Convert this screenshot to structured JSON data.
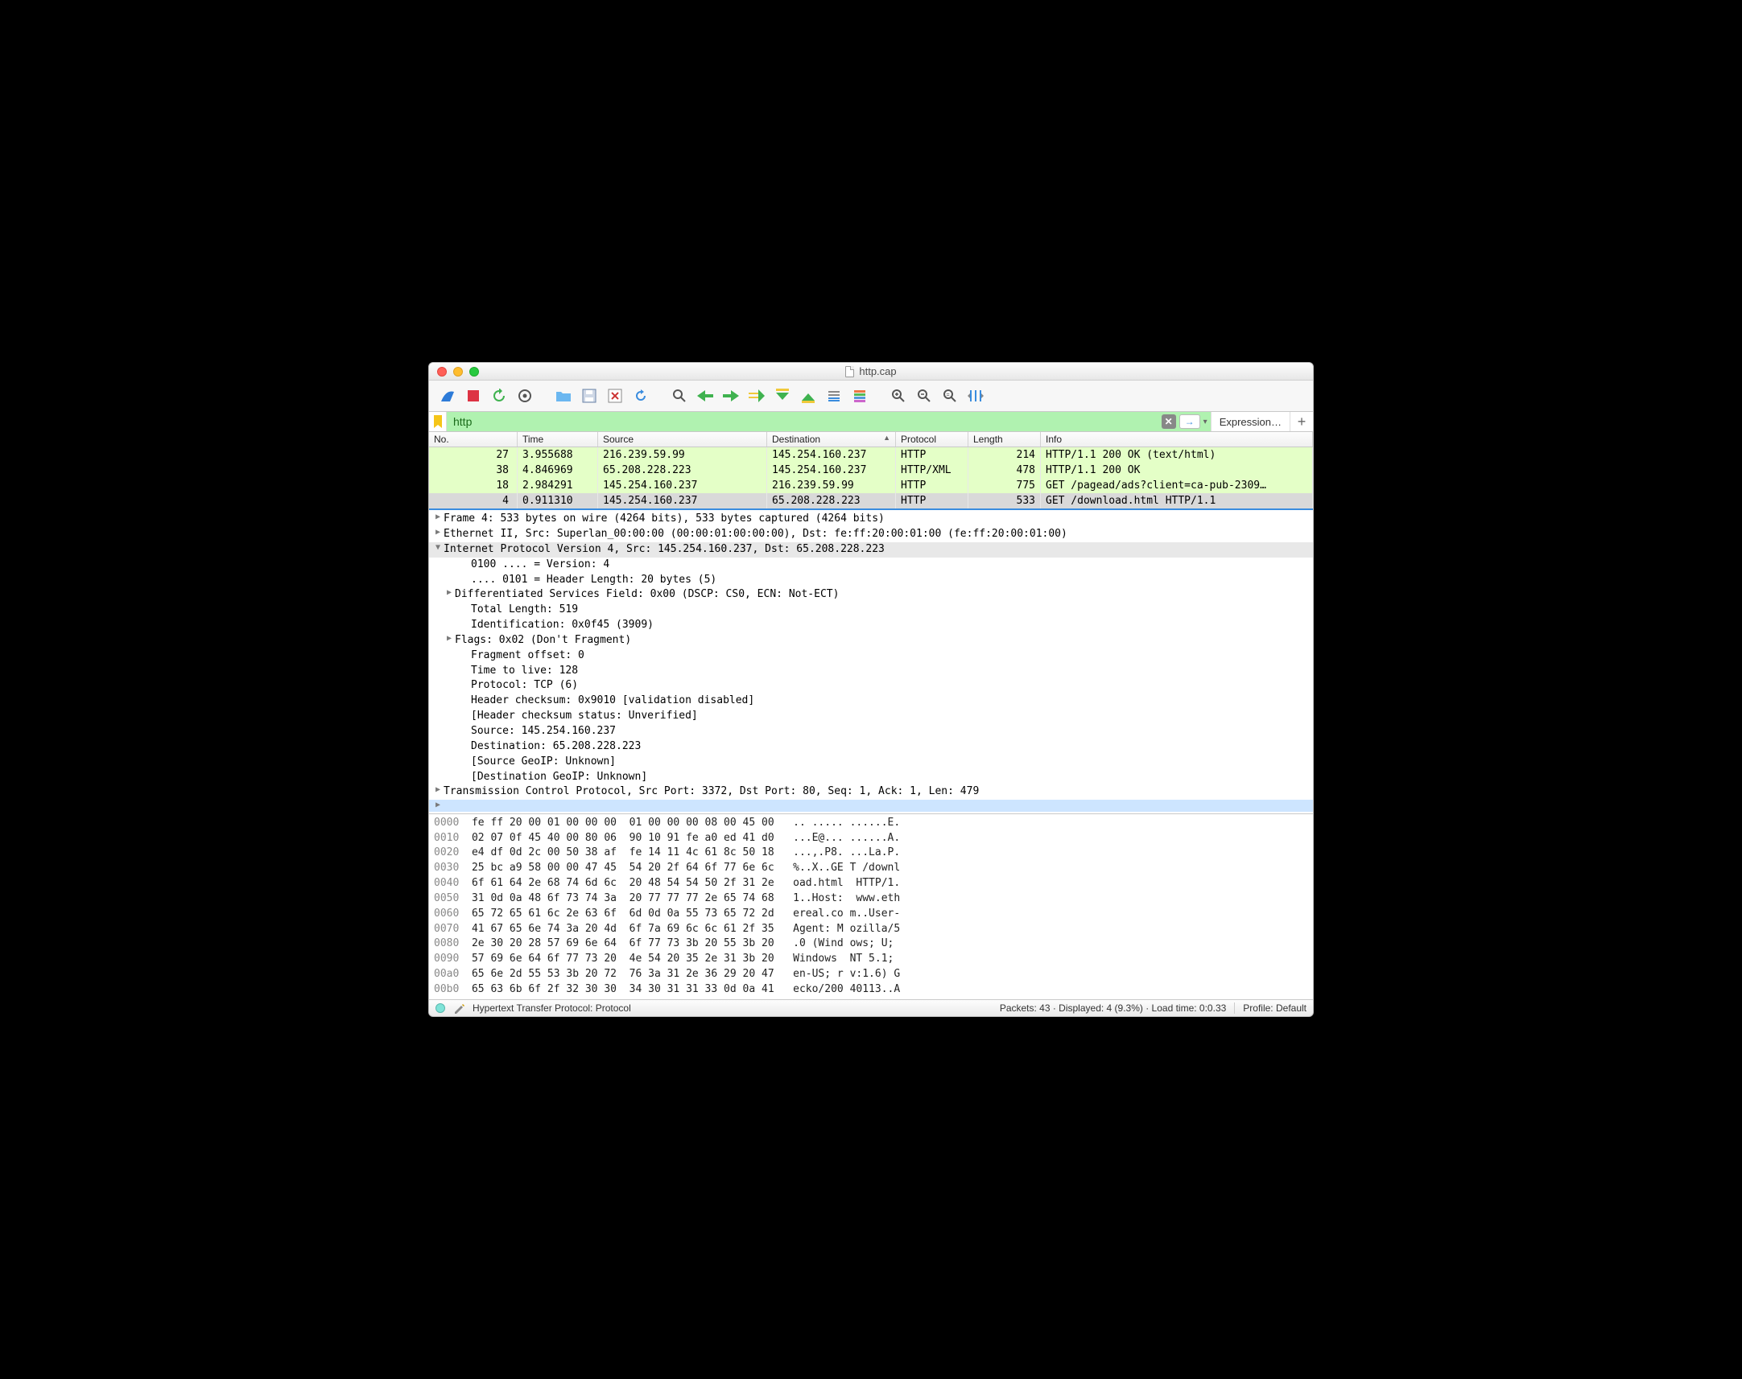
{
  "window": {
    "title": "http.cap"
  },
  "filter": {
    "value": "http",
    "expression_label": "Expression…",
    "plus": "+"
  },
  "columns": {
    "no": "No.",
    "time": "Time",
    "source": "Source",
    "destination": "Destination",
    "protocol": "Protocol",
    "length": "Length",
    "info": "Info",
    "sort_indicator": "▲"
  },
  "packets": [
    {
      "no": "27",
      "time": "3.955688",
      "src": "216.239.59.99",
      "dst": "145.254.160.237",
      "proto": "HTTP",
      "len": "214",
      "info": "HTTP/1.1 200 OK  (text/html)",
      "cls": "http"
    },
    {
      "no": "38",
      "time": "4.846969",
      "src": "65.208.228.223",
      "dst": "145.254.160.237",
      "proto": "HTTP/XML",
      "len": "478",
      "info": "HTTP/1.1 200 OK",
      "cls": "httpxml"
    },
    {
      "no": "18",
      "time": "2.984291",
      "src": "145.254.160.237",
      "dst": "216.239.59.99",
      "proto": "HTTP",
      "len": "775",
      "info": "GET /pagead/ads?client=ca-pub-2309…",
      "cls": "http"
    },
    {
      "no": "4",
      "time": "0.911310",
      "src": "145.254.160.237",
      "dst": "65.208.228.223",
      "proto": "HTTP",
      "len": "533",
      "info": "GET /download.html HTTP/1.1",
      "cls": "sel"
    }
  ],
  "details": [
    {
      "type": "node",
      "state": "closed",
      "indent": 0,
      "text": "Frame 4: 533 bytes on wire (4264 bits), 533 bytes captured (4264 bits)"
    },
    {
      "type": "node",
      "state": "closed",
      "indent": 0,
      "text": "Ethernet II, Src: Superlan_00:00:00 (00:00:01:00:00:00), Dst: fe:ff:20:00:01:00 (fe:ff:20:00:01:00)"
    },
    {
      "type": "node",
      "state": "open",
      "indent": 0,
      "text": "Internet Protocol Version 4, Src: 145.254.160.237, Dst: 65.208.228.223",
      "sel": "sel"
    },
    {
      "type": "leaf",
      "indent": 2,
      "text": "0100 .... = Version: 4"
    },
    {
      "type": "leaf",
      "indent": 2,
      "text": ".... 0101 = Header Length: 20 bytes (5)"
    },
    {
      "type": "node",
      "state": "closed",
      "indent": 1,
      "text": "Differentiated Services Field: 0x00 (DSCP: CS0, ECN: Not-ECT)"
    },
    {
      "type": "leaf",
      "indent": 2,
      "text": "Total Length: 519"
    },
    {
      "type": "leaf",
      "indent": 2,
      "text": "Identification: 0x0f45 (3909)"
    },
    {
      "type": "node",
      "state": "closed",
      "indent": 1,
      "text": "Flags: 0x02 (Don't Fragment)"
    },
    {
      "type": "leaf",
      "indent": 2,
      "text": "Fragment offset: 0"
    },
    {
      "type": "leaf",
      "indent": 2,
      "text": "Time to live: 128"
    },
    {
      "type": "leaf",
      "indent": 2,
      "text": "Protocol: TCP (6)"
    },
    {
      "type": "leaf",
      "indent": 2,
      "text": "Header checksum: 0x9010 [validation disabled]"
    },
    {
      "type": "leaf",
      "indent": 2,
      "text": "[Header checksum status: Unverified]"
    },
    {
      "type": "leaf",
      "indent": 2,
      "text": "Source: 145.254.160.237"
    },
    {
      "type": "leaf",
      "indent": 2,
      "text": "Destination: 65.208.228.223"
    },
    {
      "type": "leaf",
      "indent": 2,
      "text": "[Source GeoIP: Unknown]"
    },
    {
      "type": "leaf",
      "indent": 2,
      "text": "[Destination GeoIP: Unknown]"
    },
    {
      "type": "node",
      "state": "closed",
      "indent": 0,
      "text": "Transmission Control Protocol, Src Port: 3372, Dst Port: 80, Seq: 1, Ack: 1, Len: 479"
    },
    {
      "type": "node",
      "state": "closed",
      "indent": 0,
      "text": "",
      "sel": "sel2"
    }
  ],
  "hex": [
    {
      "off": "0000",
      "b": "fe ff 20 00 01 00 00 00  01 00 00 00 08 00 45 00",
      "a": ".. ..... ......E."
    },
    {
      "off": "0010",
      "b": "02 07 0f 45 40 00 80 06  90 10 91 fe a0 ed 41 d0",
      "a": "...E@... ......A."
    },
    {
      "off": "0020",
      "b": "e4 df 0d 2c 00 50 38 af  fe 14 11 4c 61 8c 50 18",
      "a": "...,.P8. ...La.P."
    },
    {
      "off": "0030",
      "b": "25 bc a9 58 00 00 47 45  54 20 2f 64 6f 77 6e 6c",
      "a": "%..X..GE T /downl"
    },
    {
      "off": "0040",
      "b": "6f 61 64 2e 68 74 6d 6c  20 48 54 54 50 2f 31 2e",
      "a": "oad.html  HTTP/1."
    },
    {
      "off": "0050",
      "b": "31 0d 0a 48 6f 73 74 3a  20 77 77 77 2e 65 74 68",
      "a": "1..Host:  www.eth"
    },
    {
      "off": "0060",
      "b": "65 72 65 61 6c 2e 63 6f  6d 0d 0a 55 73 65 72 2d",
      "a": "ereal.co m..User-"
    },
    {
      "off": "0070",
      "b": "41 67 65 6e 74 3a 20 4d  6f 7a 69 6c 6c 61 2f 35",
      "a": "Agent: M ozilla/5"
    },
    {
      "off": "0080",
      "b": "2e 30 20 28 57 69 6e 64  6f 77 73 3b 20 55 3b 20",
      "a": ".0 (Wind ows; U; "
    },
    {
      "off": "0090",
      "b": "57 69 6e 64 6f 77 73 20  4e 54 20 35 2e 31 3b 20",
      "a": "Windows  NT 5.1; "
    },
    {
      "off": "00a0",
      "b": "65 6e 2d 55 53 3b 20 72  76 3a 31 2e 36 29 20 47",
      "a": "en-US; r v:1.6) G"
    },
    {
      "off": "00b0",
      "b": "65 63 6b 6f 2f 32 30 30  34 30 31 31 33 0d 0a 41",
      "a": "ecko/200 40113..A"
    }
  ],
  "statusbar": {
    "left": "Hypertext Transfer Protocol: Protocol",
    "packets": "Packets: 43 · Displayed: 4 (9.3%) · Load time: 0:0.33",
    "profile": "Profile: Default"
  }
}
